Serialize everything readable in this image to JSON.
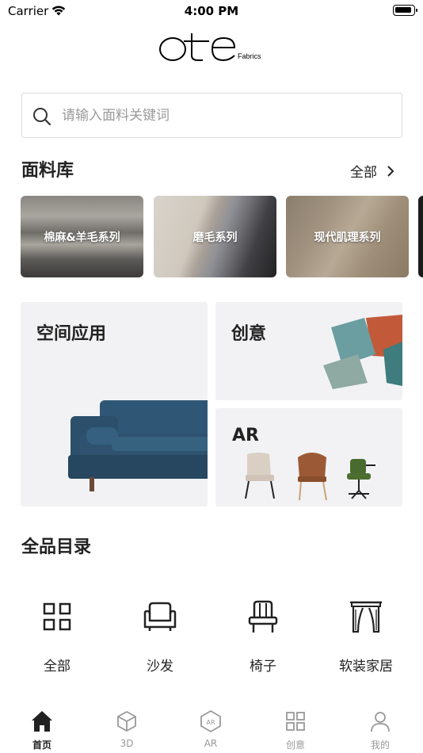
{
  "status_bar": {
    "carrier": "Carrier",
    "time": "4:00 PM"
  },
  "brand": {
    "logo_text": "ote",
    "logo_sub": "Fabrics"
  },
  "search": {
    "placeholder": "请输入面料关键词"
  },
  "fabric_library": {
    "title": "面料库",
    "see_all": "全部",
    "items": [
      {
        "label": "棉麻&羊毛系列"
      },
      {
        "label": "磨毛系列"
      },
      {
        "label": "现代肌理系列"
      },
      {
        "label": ""
      }
    ]
  },
  "features": {
    "space": {
      "title": "空间应用"
    },
    "idea": {
      "title": "创意"
    },
    "ar": {
      "title": "AR"
    }
  },
  "catalog": {
    "title": "全品目录",
    "items": [
      {
        "label": "全部",
        "icon": "grid-icon"
      },
      {
        "label": "沙发",
        "icon": "sofa-icon"
      },
      {
        "label": "椅子",
        "icon": "chair-icon"
      },
      {
        "label": "软装家居",
        "icon": "curtain-icon"
      }
    ]
  },
  "tabs": [
    {
      "label": "首页",
      "icon": "home-icon",
      "active": true
    },
    {
      "label": "3D",
      "icon": "cube-icon",
      "active": false
    },
    {
      "label": "AR",
      "icon": "ar-icon",
      "active": false
    },
    {
      "label": "创意",
      "icon": "grid-icon",
      "active": false
    },
    {
      "label": "我的",
      "icon": "user-icon",
      "active": false
    }
  ],
  "colors": {
    "accent": "#222222",
    "inactive_tab": "#999999",
    "card_bg": "#f2f2f4",
    "sofa": "#2f4f68"
  }
}
